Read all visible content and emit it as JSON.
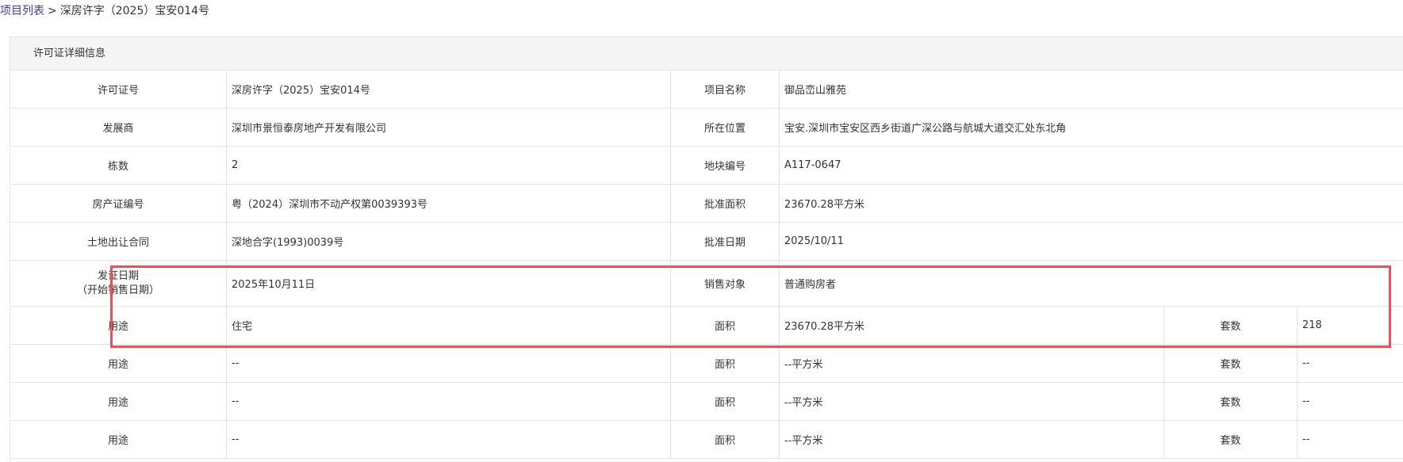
{
  "breadcrumb": {
    "link": "项目列表",
    "separator": ">",
    "current": "深房许字（2025）宝安014号"
  },
  "panel": {
    "title": "许可证详细信息"
  },
  "details": {
    "permit_no_label": "许可证号",
    "permit_no": "深房许字（2025）宝安014号",
    "project_name_label": "项目名称",
    "project_name": "御品峦山雅苑",
    "developer_label": "发展商",
    "developer": "深圳市景恒泰房地产开发有限公司",
    "location_label": "所在位置",
    "location": "宝安.深圳市宝安区西乡街道广深公路与航城大道交汇处东北角",
    "buildings_label": "栋数",
    "buildings": "2",
    "plot_no_label": "地块编号",
    "plot_no": "A117-0647",
    "property_cert_label": "房产证编号",
    "property_cert": "粤（2024）深圳市不动产权第0039393号",
    "approved_area_label": "批准面积",
    "approved_area": "23670.28平方米",
    "land_contract_label": "土地出让合同",
    "land_contract": "深地合字(1993)0039号",
    "approval_date_label": "批准日期",
    "approval_date": "2025/10/11",
    "issue_date_label_1": "发证日期",
    "issue_date_label_2": "（开始销售日期）",
    "issue_date": "2025年10月11日",
    "sales_target_label": "销售对象",
    "sales_target": "普通购房者"
  },
  "usage_rows": [
    {
      "usage_label": "用途",
      "usage": "住宅",
      "area_label": "面积",
      "area": "23670.28平方米",
      "units_label": "套数",
      "units": "218"
    },
    {
      "usage_label": "用途",
      "usage": "--",
      "area_label": "面积",
      "area": "--平方米",
      "units_label": "套数",
      "units": "--"
    },
    {
      "usage_label": "用途",
      "usage": "--",
      "area_label": "面积",
      "area": "--平方米",
      "units_label": "套数",
      "units": "--"
    },
    {
      "usage_label": "用途",
      "usage": "--",
      "area_label": "面积",
      "area": "--平方米",
      "units_label": "套数",
      "units": "--"
    }
  ],
  "colors": {
    "link": "#3a3ab0",
    "border": "#e3e3e3",
    "header_bg": "#f5f5f5",
    "highlight": "#ef4f57"
  }
}
